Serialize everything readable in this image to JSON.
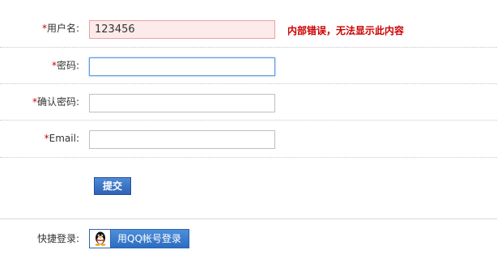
{
  "form": {
    "username": {
      "required_mark": "*",
      "label": "用户名:",
      "value": "123456",
      "error": "内部错误，无法显示此内容"
    },
    "password": {
      "required_mark": "*",
      "label": "密码:",
      "value": ""
    },
    "confirm_password": {
      "required_mark": "*",
      "label": "确认密码:",
      "value": ""
    },
    "email": {
      "required_mark": "*",
      "label": "Email:",
      "value": ""
    },
    "submit_label": "提交"
  },
  "quick_login": {
    "label": "快捷登录:",
    "qq_button_label": "用QQ帐号登录",
    "qq_icon": "qq-penguin-icon"
  },
  "colors": {
    "required": "#cc0000",
    "error_text": "#cc0000",
    "error_input_bg": "#fdeaea",
    "button_blue": "#2d62b6"
  }
}
